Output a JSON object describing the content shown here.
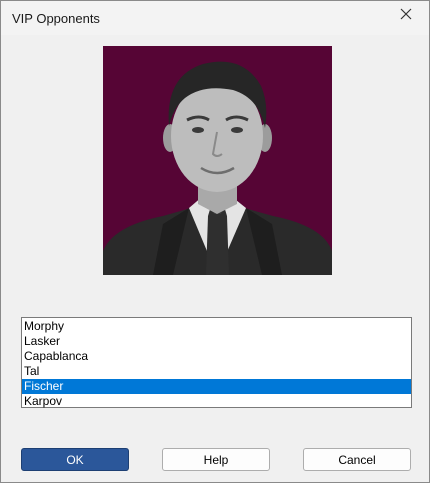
{
  "window": {
    "title": "VIP Opponents"
  },
  "list": {
    "items": [
      "Morphy",
      "Lasker",
      "Capablanca",
      "Tal",
      "Fischer",
      "Karpov"
    ],
    "selected": "Fischer"
  },
  "buttons": {
    "ok_label": "OK",
    "help_label": "Help",
    "cancel_label": "Cancel"
  },
  "colors": {
    "photo_background": "#560535",
    "selection": "#0078d7",
    "primary_button": "#2b579a"
  },
  "icons": {
    "close": "close-icon",
    "portrait": "opponent-portrait"
  }
}
